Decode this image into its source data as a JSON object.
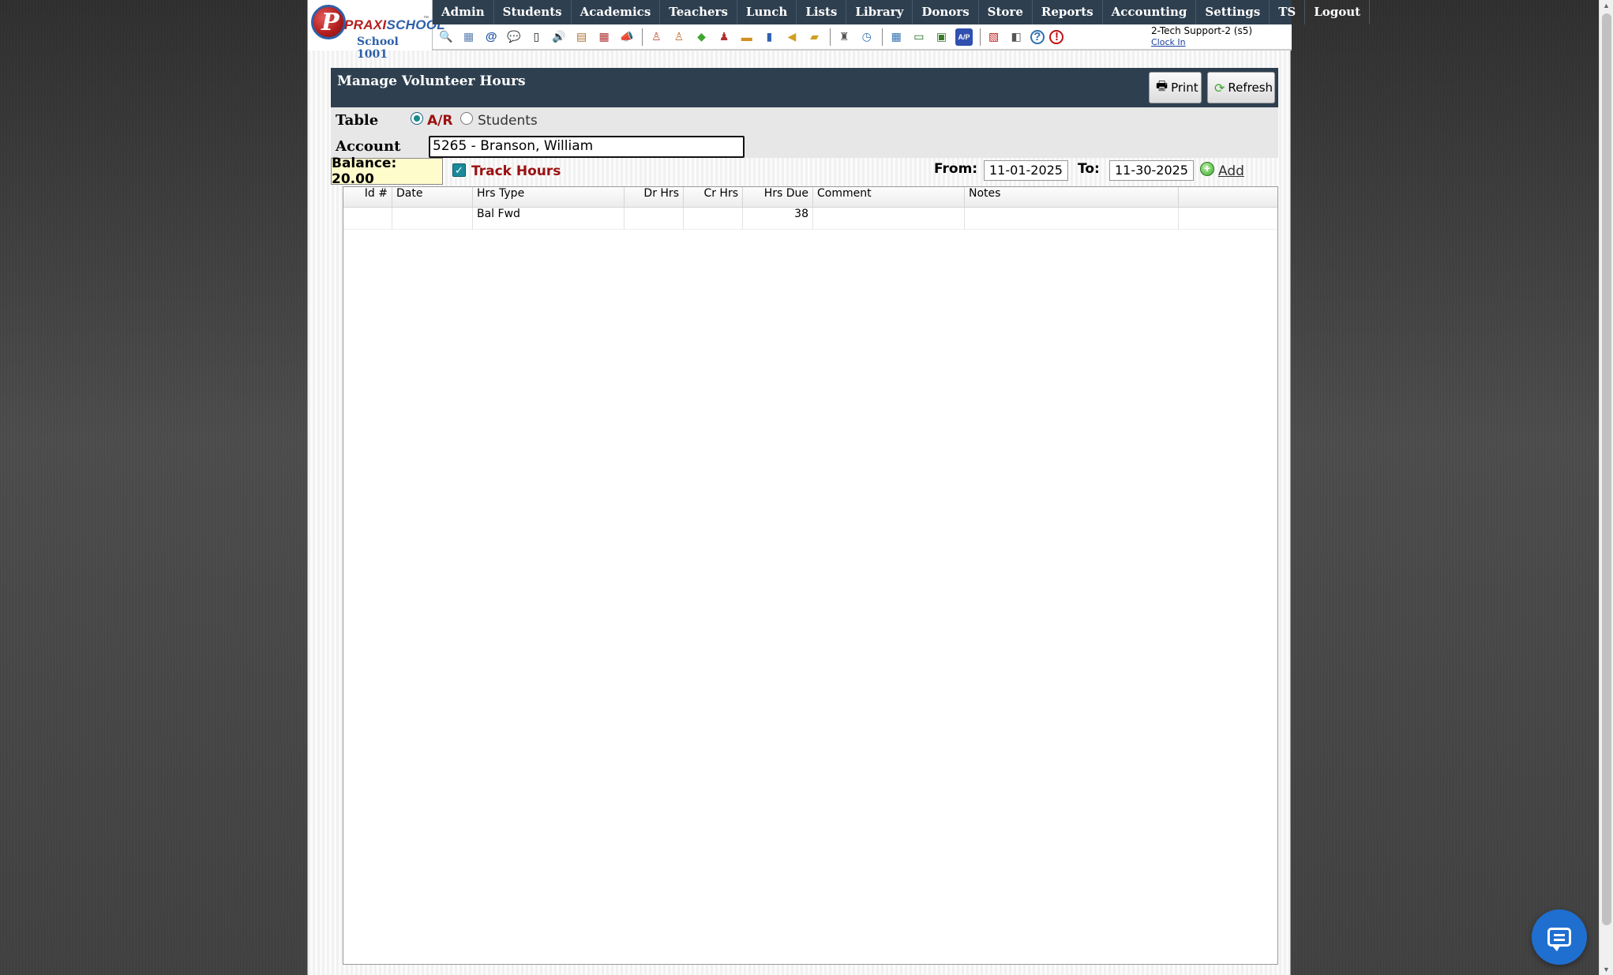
{
  "app": {
    "logo_brand_praxi": "PRAXI",
    "logo_brand_school": "SCHOOL",
    "logo_tm": "™",
    "logo_letter": "P",
    "school_name": "School 1001"
  },
  "menu": [
    "Admin",
    "Students",
    "Academics",
    "Teachers",
    "Lunch",
    "Lists",
    "Library",
    "Donors",
    "Store",
    "Reports",
    "Accounting",
    "Settings",
    "TS",
    "Logout"
  ],
  "toolbar_icons": [
    {
      "name": "search-icon",
      "glyph": "🔍",
      "color": "#7a8ca0"
    },
    {
      "name": "grid-icon",
      "glyph": "▦",
      "color": "#5b7fb0"
    },
    {
      "name": "email-icon",
      "glyph": "@",
      "color": "#1a4fa0"
    },
    {
      "name": "chat-icon",
      "glyph": "💬",
      "color": "#3ea52e"
    },
    {
      "name": "mobile-icon",
      "glyph": "▯",
      "color": "#222"
    },
    {
      "name": "speaker-icon",
      "glyph": "🔊",
      "color": "#b03030"
    },
    {
      "name": "report-icon",
      "glyph": "▤",
      "color": "#b07030"
    },
    {
      "name": "calendar-icon",
      "glyph": "▦",
      "color": "#b03030"
    },
    {
      "name": "megaphone-icon",
      "glyph": "📣",
      "color": "#b05030"
    },
    {
      "sep": true
    },
    {
      "name": "person-add-icon",
      "glyph": "♙",
      "color": "#c05030"
    },
    {
      "name": "person-icon",
      "glyph": "♙",
      "color": "#c07030"
    },
    {
      "name": "money-icon",
      "glyph": "◆",
      "color": "#3ea52e"
    },
    {
      "name": "family-icon",
      "glyph": "♟",
      "color": "#b03030"
    },
    {
      "name": "lunch-icon",
      "glyph": "▬",
      "color": "#d09020"
    },
    {
      "name": "book-icon",
      "glyph": "▮",
      "color": "#3060b0"
    },
    {
      "name": "announce-icon",
      "glyph": "◀",
      "color": "#d0a020"
    },
    {
      "name": "folder-icon",
      "glyph": "▰",
      "color": "#d0a020"
    },
    {
      "sep": true
    },
    {
      "name": "staff-icon",
      "glyph": "♜",
      "color": "#555"
    },
    {
      "name": "clock-icon",
      "glyph": "◷",
      "color": "#3070b0"
    },
    {
      "sep": true
    },
    {
      "name": "table-icon",
      "glyph": "▦",
      "color": "#3070b0"
    },
    {
      "name": "card-icon",
      "glyph": "▭",
      "color": "#1a6a1a"
    },
    {
      "name": "printer-money-icon",
      "glyph": "▣",
      "color": "#3a7a2a"
    },
    {
      "name": "ap-icon",
      "glyph": "A/P",
      "color": "#3050b0"
    },
    {
      "sep": true
    },
    {
      "name": "pdf-icon",
      "glyph": "▧",
      "color": "#c02020"
    },
    {
      "name": "export-icon",
      "glyph": "◧",
      "color": "#555"
    },
    {
      "name": "help-icon",
      "glyph": "?",
      "color": "#3070b0"
    },
    {
      "name": "stop-icon",
      "glyph": "!",
      "color": "#c01010"
    }
  ],
  "user": {
    "name": "2-Tech Support-2 (s5)",
    "clock_in": "Clock In"
  },
  "panel": {
    "title": "Manage Volunteer Hours",
    "print_label": "Print",
    "refresh_label": "Refresh"
  },
  "form": {
    "table_label": "Table",
    "radio_ar": "A/R",
    "radio_students": "Students",
    "selected_table": "A/R",
    "account_label": "Account",
    "account_value": "5265 - Branson, William",
    "balance": "Balance: 20.00",
    "track_hours_label": "Track Hours",
    "track_hours_checked": true,
    "from_label": "From:",
    "from_value": "11-01-2025",
    "to_label": "To:",
    "to_value": "11-30-2025",
    "add_label": "Add"
  },
  "grid": {
    "columns": [
      "Id #",
      "Date",
      "Hrs Type",
      "Dr Hrs",
      "Cr Hrs",
      "Hrs Due",
      "Comment",
      "Notes"
    ],
    "rows": [
      {
        "id": "",
        "date": "",
        "hrs_type": "Bal Fwd",
        "dr": "",
        "cr": "",
        "due": "38",
        "comment": "",
        "notes": ""
      }
    ]
  },
  "colors": {
    "menu_bg": "#2e3f4f",
    "accent_red": "#9b1010",
    "balance_bg": "#fffccc",
    "chat_blue": "#1f6fd0"
  }
}
